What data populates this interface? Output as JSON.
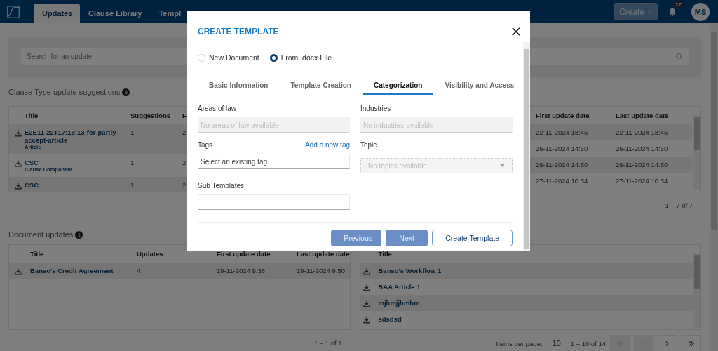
{
  "header": {
    "tabs": [
      {
        "label": "Updates",
        "selected": true
      },
      {
        "label": "Clause Library",
        "selected": false
      },
      {
        "label": "Templ",
        "selected": false
      }
    ],
    "create_button": "Create",
    "notifications": "27",
    "avatar": "MS"
  },
  "search": {
    "placeholder": "Search for an update"
  },
  "clause_section": {
    "title": "Clause Type update suggestions",
    "count": "5",
    "left_columns": [
      "Title",
      "Suggestions",
      "F"
    ],
    "right_columns": [
      "First update date",
      "Last update date"
    ],
    "rows": [
      {
        "title": "E2E11-22T17:13:13-for-partly-accept-article",
        "kind_label": "Article",
        "suggestions": "1",
        "column_3": "2"
      },
      {
        "title": "CSC",
        "kind_label": "Clause Component",
        "suggestions": "1",
        "column_3": "2"
      },
      {
        "title": "CSC",
        "suggestions": "1",
        "column_3": "2"
      }
    ],
    "date_rows": [
      {
        "first": "22-11-2024 18:46",
        "last": "22-11-2024 18:46"
      },
      {
        "first": "26-11-2024 14:50",
        "last": "26-11-2024 14:50"
      },
      {
        "first": "26-11-2024 14:50",
        "last": "26-11-2024 14:50"
      },
      {
        "first": "27-11-2024 10:34",
        "last": "27-11-2024 10:34"
      }
    ],
    "pagination": "1 – 7 of 7"
  },
  "document_section": {
    "title": "Document updates",
    "count": "1",
    "left_table": {
      "columns": [
        "Title",
        "Updates",
        "First update date",
        "Last update date"
      ],
      "rows": [
        {
          "title": "Banso's Credit Agreement",
          "updates": "4",
          "first": "29-11-2024 9:38",
          "last": "29-11-2024 9:50"
        }
      ],
      "pagination": "1 – 1 of 1"
    },
    "right_table": {
      "columns": [
        "Title"
      ],
      "rows": [
        {
          "title": "Banso's Workflow 1"
        },
        {
          "title": "BAA Article 1"
        },
        {
          "title": "mjhmjjhmhm"
        },
        {
          "title": "sdsdsd"
        }
      ],
      "items_per_page_label": "Items per page:",
      "items_per_page": "10",
      "range": "1 – 10 of 14",
      "nav_buttons": [
        {
          "kind": "first",
          "disabled": true
        },
        {
          "kind": "previous",
          "disabled": true
        },
        {
          "kind": "next",
          "disabled": false
        },
        {
          "kind": "last",
          "disabled": false
        }
      ]
    }
  },
  "modal": {
    "title": "CREATE TEMPLATE",
    "radios": [
      {
        "label": "New Document",
        "selected": false
      },
      {
        "label": "From .docx File",
        "selected": true
      }
    ],
    "tabs": [
      {
        "label": "Basic Information",
        "selected": false
      },
      {
        "label": "Template Creation",
        "selected": false
      },
      {
        "label": "Categorization",
        "selected": true
      },
      {
        "label": "Visibility and Access",
        "selected": false
      }
    ],
    "fields": [
      {
        "label": "Areas of law",
        "kind": "input",
        "placeholder": "No areas of law available",
        "disabled": true
      },
      {
        "label": "Industries",
        "kind": "input",
        "placeholder": "No industries available",
        "disabled": true
      },
      {
        "label": "Tags",
        "kind": "input",
        "placeholder": "Select an existing tag",
        "disabled": false,
        "link": "Add a new tag"
      },
      {
        "label": "Topic",
        "kind": "select",
        "placeholder": "No topics available",
        "disabled": true
      },
      {
        "label": "Sub Templates",
        "kind": "input",
        "disabled": false
      }
    ],
    "buttons": [
      {
        "label": "Previous",
        "kind": "filled",
        "disabled": true
      },
      {
        "label": "Next",
        "kind": "filled",
        "disabled": true
      },
      {
        "label": "Create Template",
        "kind": "outline",
        "disabled": false
      }
    ]
  }
}
